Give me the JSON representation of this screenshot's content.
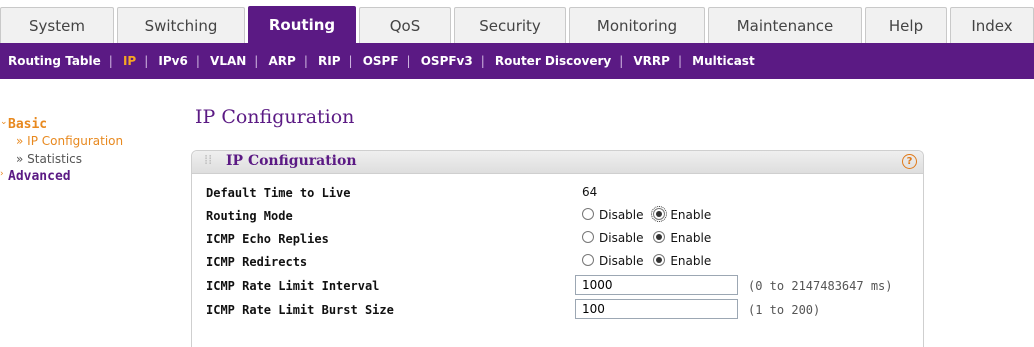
{
  "tabs": [
    {
      "label": "System"
    },
    {
      "label": "Switching"
    },
    {
      "label": "Routing"
    },
    {
      "label": "QoS"
    },
    {
      "label": "Security"
    },
    {
      "label": "Monitoring"
    },
    {
      "label": "Maintenance"
    },
    {
      "label": "Help"
    },
    {
      "label": "Index"
    }
  ],
  "active_tab": "Routing",
  "subnav": [
    "Routing Table",
    "IP",
    "IPv6",
    "VLAN",
    "ARP",
    "RIP",
    "OSPF",
    "OSPFv3",
    "Router Discovery",
    "VRRP",
    "Multicast"
  ],
  "active_subnav": "IP",
  "sidebar": {
    "basic": "Basic",
    "items": [
      {
        "label": "» IP Configuration"
      },
      {
        "label": "» Statistics"
      }
    ],
    "advanced": "Advanced"
  },
  "page_title": "IP Configuration",
  "panel": {
    "title": "IP Configuration",
    "help_icon": "?",
    "rows": [
      {
        "label": "Default Time to Live",
        "value": "64"
      },
      {
        "label": "Routing Mode",
        "disable": "Disable",
        "enable": "Enable",
        "selected": "Enable"
      },
      {
        "label": "ICMP Echo Replies",
        "disable": "Disable",
        "enable": "Enable",
        "selected": "Enable"
      },
      {
        "label": "ICMP Redirects",
        "disable": "Disable",
        "enable": "Enable",
        "selected": "Enable"
      },
      {
        "label": "ICMP Rate Limit Interval",
        "value": "1000",
        "hint": "(0 to 2147483647 ms)"
      },
      {
        "label": "ICMP Rate Limit Burst Size",
        "value": "100",
        "hint": "(1 to 200)"
      }
    ]
  },
  "colors": {
    "brand": "#5b1a84",
    "accent": "#e8891f"
  }
}
